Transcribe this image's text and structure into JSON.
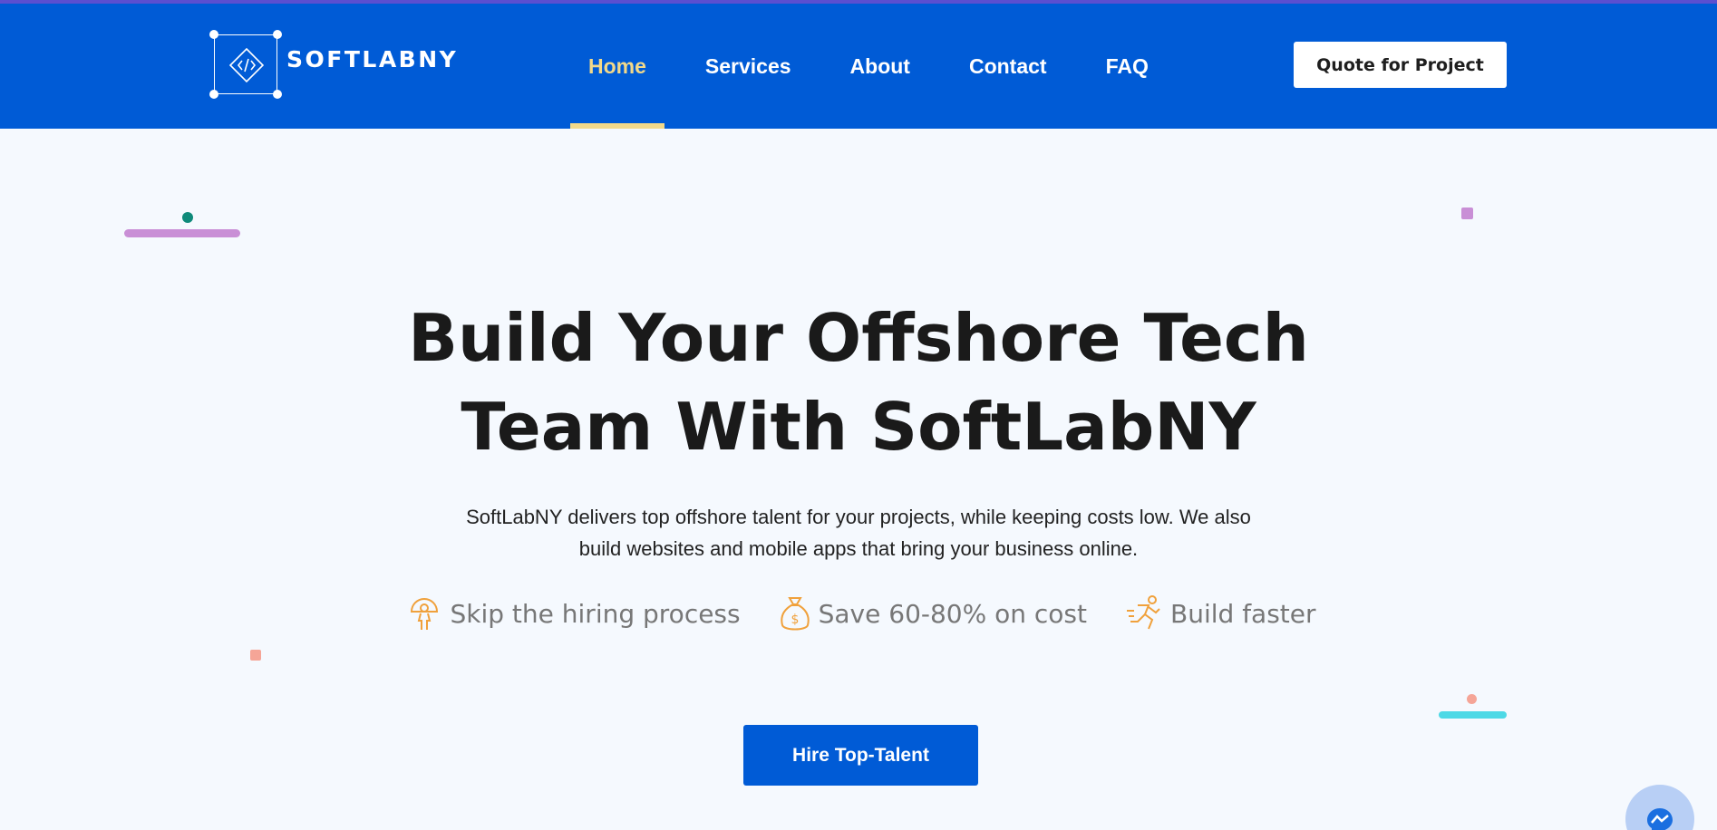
{
  "brand": {
    "name": "SOFTLABNY"
  },
  "nav": {
    "items": [
      {
        "label": "Home",
        "active": true
      },
      {
        "label": "Services",
        "active": false
      },
      {
        "label": "About",
        "active": false
      },
      {
        "label": "Contact",
        "active": false
      },
      {
        "label": "FAQ",
        "active": false
      }
    ],
    "cta_label": "Quote for Project"
  },
  "hero": {
    "title_line1": "Build Your Offshore Tech",
    "title_line2": "Team With SoftLabNY",
    "description_line1": "SoftLabNY delivers top offshore talent for your projects, while keeping costs low. We also",
    "description_line2": "build websites and mobile apps that bring your business online.",
    "features": [
      {
        "icon": "person-hanger-icon",
        "label": "Skip the hiring process"
      },
      {
        "icon": "money-bag-icon",
        "label": "Save 60-80% on cost"
      },
      {
        "icon": "runner-icon",
        "label": "Build faster"
      }
    ],
    "button_label": "Hire Top-Talent"
  },
  "colors": {
    "primary": "#005bd6",
    "nav_active": "#f2d98a",
    "feature_icon": "#f0a13c",
    "title": "#1a1a1a"
  }
}
